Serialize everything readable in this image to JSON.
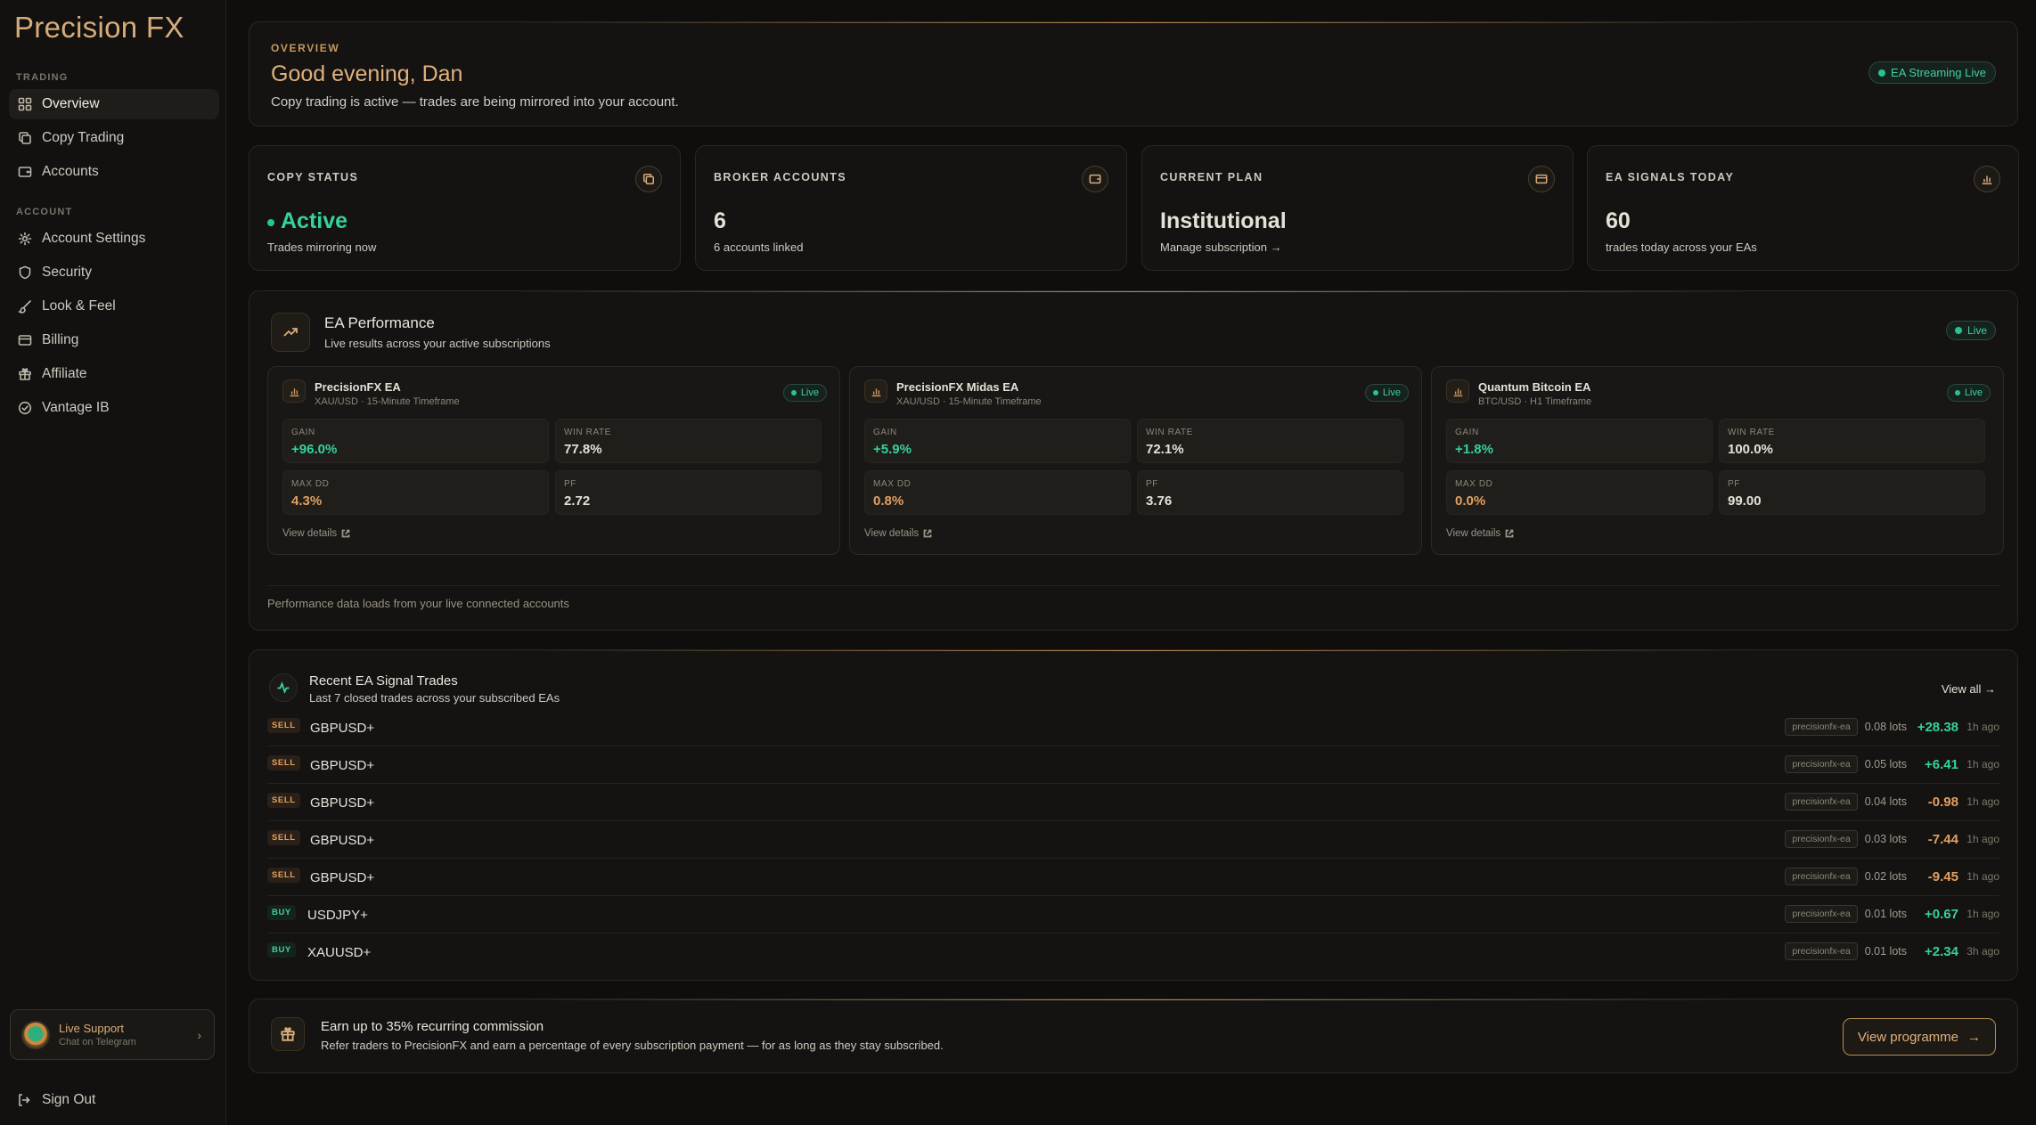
{
  "brand": {
    "name": "Precision FX"
  },
  "sidebar": {
    "sections": [
      {
        "label": "TRADING",
        "items": [
          "Overview",
          "Copy Trading",
          "Accounts"
        ]
      },
      {
        "label": "ACCOUNT",
        "items": [
          "Account Settings",
          "Security",
          "Look & Feel",
          "Billing",
          "Affiliate",
          "Vantage IB"
        ]
      }
    ],
    "active": "Overview",
    "support": {
      "title": "Live Support",
      "subtitle": "Chat on Telegram"
    },
    "signout": "Sign Out"
  },
  "overview": {
    "eyebrow": "OVERVIEW",
    "greeting": "Good evening, Dan",
    "subtitle": "Copy trading is active — trades are being mirrored into your account.",
    "status_pill": "EA Streaming Live"
  },
  "stats": [
    {
      "label": "COPY STATUS",
      "value": "Active",
      "sub": "Trades mirroring now",
      "icon": "copy-icon"
    },
    {
      "label": "BROKER ACCOUNTS",
      "value": "6",
      "sub": "6 accounts linked",
      "icon": "wallet-icon"
    },
    {
      "label": "CURRENT PLAN",
      "value": "Institutional",
      "sub": "Manage subscription →",
      "icon": "credit-card-icon"
    },
    {
      "label": "EA SIGNALS TODAY",
      "value": "60",
      "sub": "trades today across your EAs",
      "icon": "bar-chart-icon"
    }
  ],
  "performance": {
    "title": "EA Performance",
    "subtitle": "Live results across your active subscriptions",
    "live": "Live",
    "footer": "Performance data loads from your live connected accounts",
    "view_details": "View details",
    "eas": [
      {
        "name": "PrecisionFX EA",
        "timeframe": "XAU/USD · 15-Minute Timeframe",
        "live": "Live",
        "gain_label": "GAIN",
        "gain": "+96.0%",
        "winrate_label": "WIN RATE",
        "winrate": "77.8%",
        "maxdd_label": "MAX DD",
        "maxdd": "4.3%",
        "pf_label": "PF",
        "pf": "2.72"
      },
      {
        "name": "PrecisionFX Midas EA",
        "timeframe": "XAU/USD · 15-Minute Timeframe",
        "live": "Live",
        "gain_label": "GAIN",
        "gain": "+5.9%",
        "winrate_label": "WIN RATE",
        "winrate": "72.1%",
        "maxdd_label": "MAX DD",
        "maxdd": "0.8%",
        "pf_label": "PF",
        "pf": "3.76"
      },
      {
        "name": "Quantum Bitcoin EA",
        "timeframe": "BTC/USD · H1 Timeframe",
        "live": "Live",
        "gain_label": "GAIN",
        "gain": "+1.8%",
        "winrate_label": "WIN RATE",
        "winrate": "100.0%",
        "maxdd_label": "MAX DD",
        "maxdd": "0.0%",
        "pf_label": "PF",
        "pf": "99.00"
      }
    ]
  },
  "trades": {
    "title": "Recent EA Signal Trades",
    "subtitle": "Last 7 closed trades across your subscribed EAs",
    "view_all": "View all →",
    "rows": [
      {
        "side": "SELL",
        "symbol": "GBPUSD+",
        "ea": "precisionfx-ea",
        "lots": "0.08 lots",
        "pnl": "+28.38",
        "ago": "1h ago"
      },
      {
        "side": "SELL",
        "symbol": "GBPUSD+",
        "ea": "precisionfx-ea",
        "lots": "0.05 lots",
        "pnl": "+6.41",
        "ago": "1h ago"
      },
      {
        "side": "SELL",
        "symbol": "GBPUSD+",
        "ea": "precisionfx-ea",
        "lots": "0.04 lots",
        "pnl": "-0.98",
        "ago": "1h ago"
      },
      {
        "side": "SELL",
        "symbol": "GBPUSD+",
        "ea": "precisionfx-ea",
        "lots": "0.03 lots",
        "pnl": "-7.44",
        "ago": "1h ago"
      },
      {
        "side": "SELL",
        "symbol": "GBPUSD+",
        "ea": "precisionfx-ea",
        "lots": "0.02 lots",
        "pnl": "-9.45",
        "ago": "1h ago"
      },
      {
        "side": "BUY",
        "symbol": "USDJPY+",
        "ea": "precisionfx-ea",
        "lots": "0.01 lots",
        "pnl": "+0.67",
        "ago": "1h ago"
      },
      {
        "side": "BUY",
        "symbol": "XAUUSD+",
        "ea": "precisionfx-ea",
        "lots": "0.01 lots",
        "pnl": "+2.34",
        "ago": "3h ago"
      }
    ]
  },
  "affiliate": {
    "title": "Earn up to 35% recurring commission",
    "subtitle": "Refer traders to PrecisionFX and earn a percentage of every subscription payment — for as long as they stay subscribed.",
    "button": "View programme"
  },
  "colors": {
    "accent": "#d7ab79",
    "positive": "#34d29c",
    "negative": "#e4a05e",
    "background": "#0f0e0d"
  }
}
